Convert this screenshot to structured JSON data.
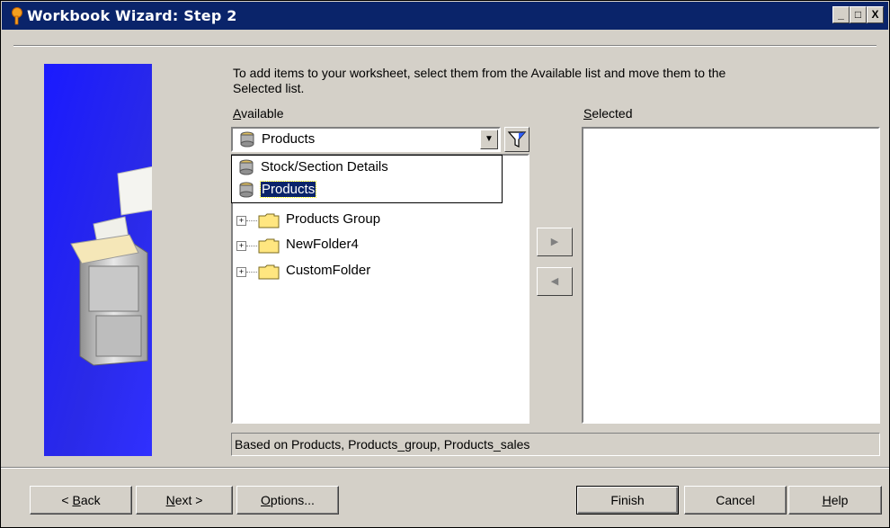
{
  "window": {
    "title": "Workbook Wizard: Step 2",
    "controls": {
      "minimize": "_",
      "maximize": "□",
      "close": "X"
    }
  },
  "instructions": "To add items to your worksheet, select them from the Available list and move them to the Selected list.",
  "available": {
    "label": "Available",
    "mnemonic": "A",
    "label_rest": "vailable",
    "combo_value": "Products",
    "dropdown_items": [
      {
        "label": "Stock/Section Details",
        "selected": false
      },
      {
        "label": "Products",
        "selected": true
      }
    ],
    "tree": [
      {
        "label": "Products Group",
        "expander": "+"
      },
      {
        "label": "NewFolder4",
        "expander": "+"
      },
      {
        "label": "CustomFolder",
        "expander": "+"
      }
    ]
  },
  "selected": {
    "mnemonic": "S",
    "label_rest": "elected"
  },
  "move_buttons": {
    "add": "▶",
    "remove": "◀"
  },
  "status_text": "Based on Products, Products_group, Products_sales",
  "buttons": {
    "back": {
      "prefix": "< ",
      "mnemonic": "B",
      "rest": "ack"
    },
    "next": {
      "mnemonic": "N",
      "rest": "ext >"
    },
    "options": {
      "mnemonic": "O",
      "rest": "ptions..."
    },
    "finish": "Finish",
    "cancel": "Cancel",
    "help": {
      "mnemonic": "H",
      "rest": "elp"
    }
  },
  "colors": {
    "titlebar": "#0a246a",
    "panel": "#d4d0c8",
    "graphic_blue": "#1e1ef0",
    "selection": "#0a246a"
  }
}
